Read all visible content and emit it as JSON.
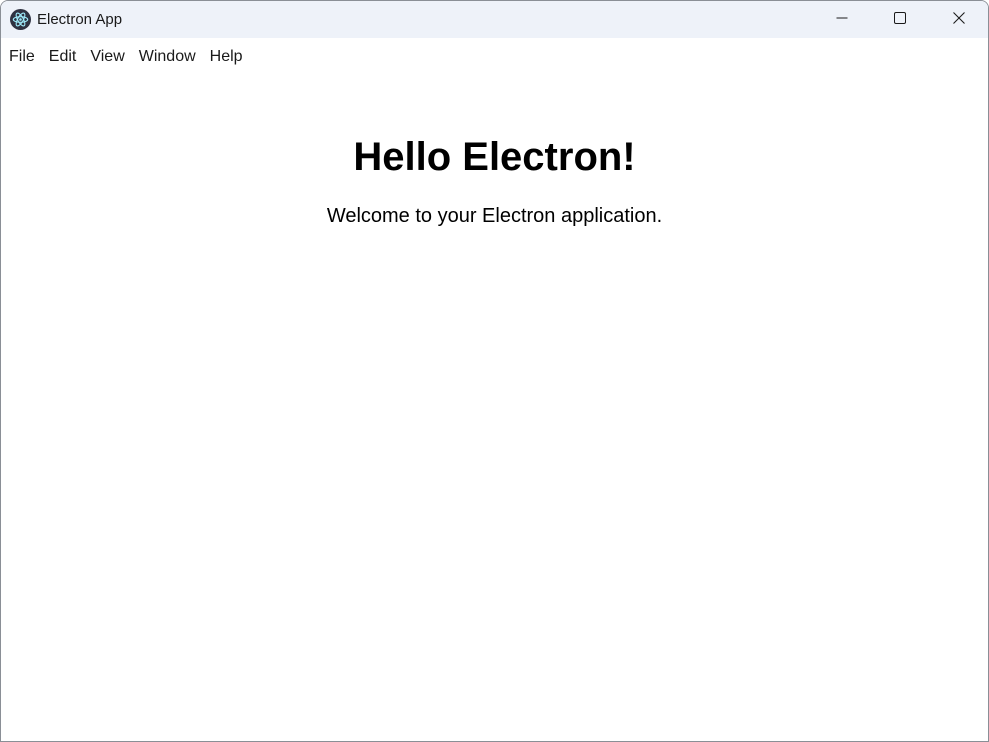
{
  "window": {
    "title": "Electron App",
    "icon": "electron-logo-icon",
    "controls": {
      "minimize": "minimize-icon",
      "maximize": "maximize-icon",
      "close": "close-icon"
    }
  },
  "menubar": {
    "items": [
      {
        "label": "File"
      },
      {
        "label": "Edit"
      },
      {
        "label": "View"
      },
      {
        "label": "Window"
      },
      {
        "label": "Help"
      }
    ]
  },
  "main": {
    "heading": "Hello Electron!",
    "subtext": "Welcome to your Electron application."
  },
  "colors": {
    "titlebar": "#eef2f9",
    "background": "#ffffff",
    "text": "#000000"
  }
}
